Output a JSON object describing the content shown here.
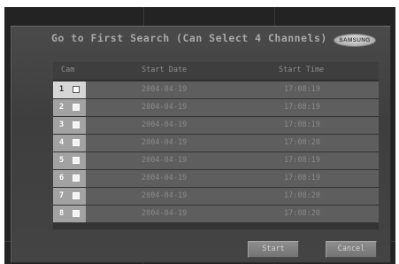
{
  "dialog": {
    "title": "Go to First Search (Can Select 4 Channels)",
    "logo_text": "SAMSUNG"
  },
  "table": {
    "headers": {
      "cam": "Cam",
      "start_date": "Start Date",
      "start_time": "Start Time"
    },
    "rows": [
      {
        "cam": "1",
        "date": "2004-04-19",
        "time": "17:08:19",
        "selected": true
      },
      {
        "cam": "2",
        "date": "2004-04-19",
        "time": "17:08:19",
        "selected": false
      },
      {
        "cam": "3",
        "date": "2004-04-19",
        "time": "17:08:19",
        "selected": false
      },
      {
        "cam": "4",
        "date": "2004-04-19",
        "time": "17:08:20",
        "selected": false
      },
      {
        "cam": "5",
        "date": "2004-04-19",
        "time": "17:08:19",
        "selected": false
      },
      {
        "cam": "6",
        "date": "2004-04-19",
        "time": "17:08:19",
        "selected": false
      },
      {
        "cam": "7",
        "date": "2004-04-19",
        "time": "17:08:20",
        "selected": false
      },
      {
        "cam": "8",
        "date": "2004-04-19",
        "time": "17:08:20",
        "selected": false
      }
    ]
  },
  "buttons": {
    "start": "Start",
    "cancel": "Cancel"
  },
  "colors": {
    "screen_bg": "#232323",
    "panel_bg": "#444444",
    "cam_cell": "#a2a2a2",
    "cam_cell_selected": "#d6d6d6",
    "data_cell": "#5e5e5e",
    "button": "#808080"
  },
  "icons": {
    "checkbox": "checkbox-icon",
    "logo": "samsung-logo"
  }
}
